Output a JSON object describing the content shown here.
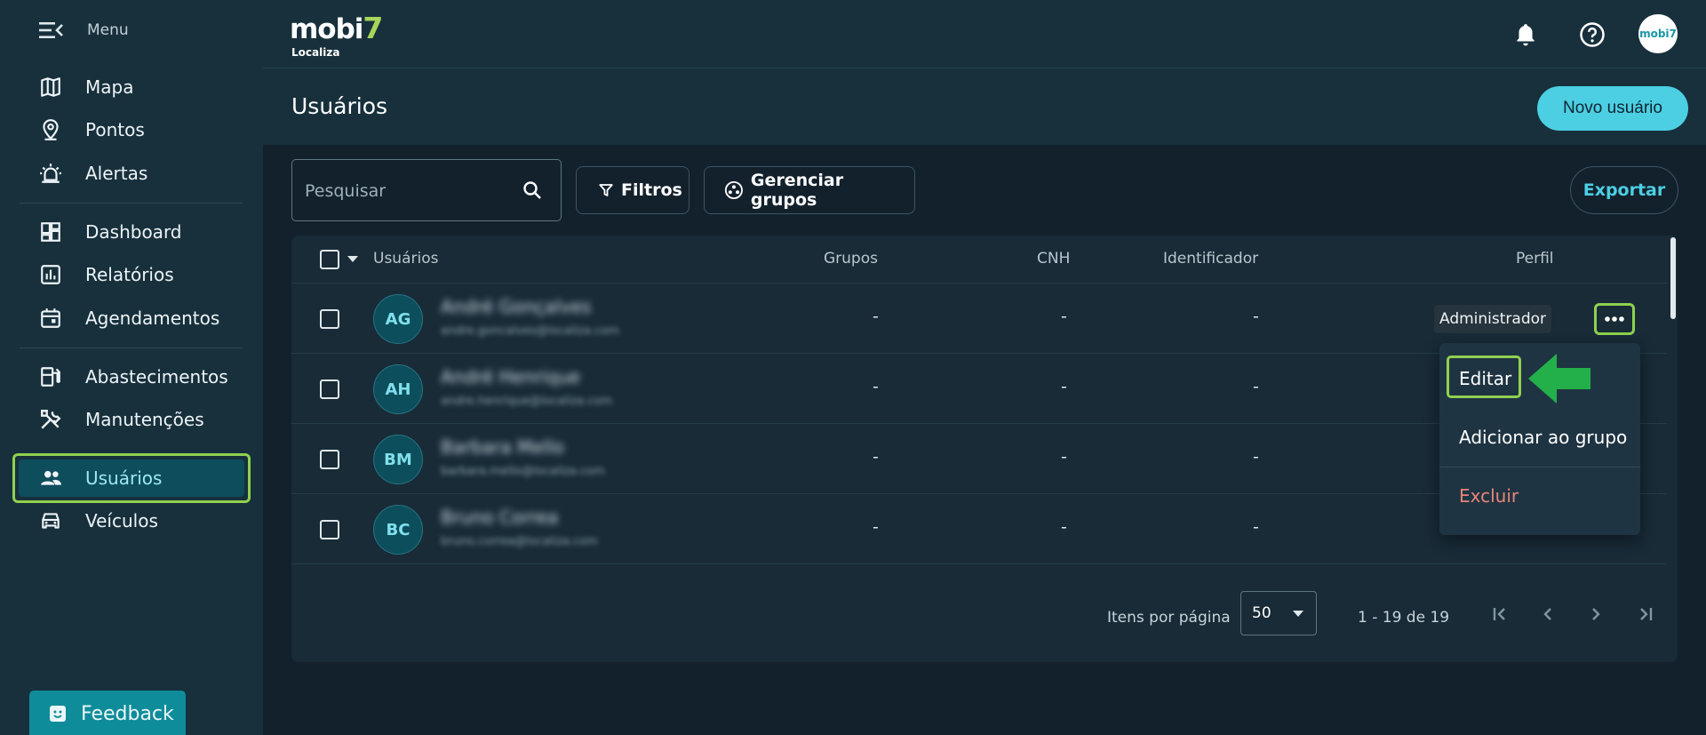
{
  "sidebar": {
    "menu_label": "Menu",
    "items": [
      {
        "label": "Mapa",
        "icon": "map-icon"
      },
      {
        "label": "Pontos",
        "icon": "location-pin-icon"
      },
      {
        "label": "Alertas",
        "icon": "siren-icon"
      },
      {
        "label": "Dashboard",
        "icon": "dashboard-icon"
      },
      {
        "label": "Relatórios",
        "icon": "bar-chart-icon"
      },
      {
        "label": "Agendamentos",
        "icon": "calendar-icon"
      },
      {
        "label": "Abastecimentos",
        "icon": "fuel-pump-icon"
      },
      {
        "label": "Manutenções",
        "icon": "tools-icon"
      },
      {
        "label": "Usuários",
        "icon": "users-icon",
        "active": true
      },
      {
        "label": "Veículos",
        "icon": "car-icon"
      }
    ],
    "feedback_label": "Feedback"
  },
  "topbar": {
    "logo_text": "mobi",
    "logo_digit": "7",
    "logo_sub": "Localiza",
    "avatar_text": "mobi7"
  },
  "header": {
    "title": "Usuários",
    "new_user_label": "Novo usuário"
  },
  "toolbar": {
    "search_placeholder": "Pesquisar",
    "filters_label": "Filtros",
    "manage_groups_label": "Gerenciar grupos",
    "export_label": "Exportar"
  },
  "table": {
    "columns": {
      "users": "Usuários",
      "groups": "Grupos",
      "cnh": "CNH",
      "identifier": "Identificador",
      "profile": "Perfil"
    },
    "rows": [
      {
        "initials": "AG",
        "name": "André Gonçalves",
        "email": "andre.goncalves@localiza.com",
        "groups": "-",
        "cnh": "-",
        "identifier": "-",
        "profile": "Administrador"
      },
      {
        "initials": "AH",
        "name": "André Henrique",
        "email": "andre.henrique@localiza.com",
        "groups": "-",
        "cnh": "-",
        "identifier": "-",
        "profile": ""
      },
      {
        "initials": "BM",
        "name": "Barbara Mello",
        "email": "barbara.mello@localiza.com",
        "groups": "-",
        "cnh": "-",
        "identifier": "-",
        "profile": ""
      },
      {
        "initials": "BC",
        "name": "Bruno Correa",
        "email": "bruno.correa@localiza.com",
        "groups": "-",
        "cnh": "-",
        "identifier": "-",
        "profile": ""
      }
    ],
    "footer": {
      "items_per_page_label": "Itens por página",
      "items_per_page_value": "50",
      "range": "1 - 19 de 19"
    }
  },
  "context_menu": {
    "edit": "Editar",
    "add_to_group": "Adicionar ao grupo",
    "delete": "Excluir"
  },
  "colors": {
    "accent": "#4ccfe3",
    "highlight": "#8fd14f",
    "danger": "#e8857a",
    "arrow": "#23b04a"
  }
}
